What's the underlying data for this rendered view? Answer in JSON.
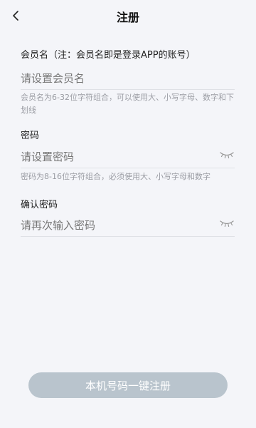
{
  "header": {
    "back_icon": "chevron-left-icon",
    "title": "注册"
  },
  "username": {
    "label": "会员名（注：会员名即是登录APP的账号）",
    "placeholder": "请设置会员名",
    "value": "",
    "hint": "会员名为6-32位字符组合，可以使用大、小写字母、数字和下划线"
  },
  "password": {
    "label": "密码",
    "placeholder": "请设置密码",
    "value": "",
    "toggle_icon": "eye-closed-icon",
    "hint": "密码为8-16位字符组合，必须使用大、小写字母和数字"
  },
  "confirm_password": {
    "label": "确认密码",
    "placeholder": "请再次输入密码",
    "value": "",
    "toggle_icon": "eye-closed-icon"
  },
  "actions": {
    "one_key_register_label": "本机号码一键注册"
  },
  "colors": {
    "background": "#f4f5f9",
    "button_bg": "#b9c4cd",
    "button_text": "#ffffff",
    "hint_text": "#9a9ca3",
    "divider": "#dfe1e6"
  }
}
